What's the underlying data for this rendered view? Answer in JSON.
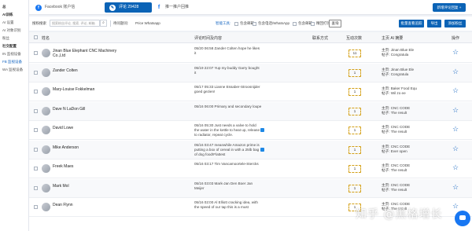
{
  "sidebar": {
    "items": [
      {
        "label": "总",
        "type": "group"
      },
      {
        "label": "AI训练",
        "type": "group"
      },
      {
        "label": "AI 设置",
        "type": "item"
      },
      {
        "label": "AI 对象识别",
        "type": "item"
      },
      {
        "label": "粉丝",
        "type": "item"
      },
      {
        "label": "社交配置",
        "type": "group"
      },
      {
        "label": "IN 监视设备",
        "type": "item"
      },
      {
        "label": "FB 监视设备",
        "type": "active"
      },
      {
        "label": "WA 监视设备",
        "type": "item"
      }
    ]
  },
  "topbar": {
    "tabs": [
      {
        "label": "Facebook 账户信",
        "icon": "f"
      },
      {
        "label": "评论  29428",
        "icon": "✎"
      },
      {
        "label": "推一推户回推",
        "icon": "f"
      }
    ],
    "new_button": "新增评论回复 +"
  },
  "toolbar": {
    "search_label": "搜粉搜索",
    "search_placeholder": "搜索粉丝评论, 搜索, 评论, 邮箱",
    "search_icon": "search-icon",
    "filter_label": "待问题问:",
    "filter_value": "Price  Whatsapp",
    "tag_label": "智能工具:",
    "checks": [
      "包含邮箱",
      "包含电话/WhatsApp",
      "包含邮箱",
      "精回打领"
    ],
    "query_button": "查询",
    "batch_button": "批量查看追踪",
    "export_button": "导出",
    "add_button": "添加粉丝"
  },
  "table": {
    "headers": [
      "姓名",
      "评论时间及内容",
      "联系方式",
      "互动次数",
      "主页 Al 摘要",
      "操作"
    ],
    "rows": [
      {
        "name": "Jinan Blue Elephant CNC Machinery Co.,Ltd",
        "message": "05/20 06:58 Zander Colten hope he likes it",
        "flag": false,
        "count": "11",
        "rel1": "主页: Jinan Blue Ele",
        "rel2": "帖子: Congratula"
      },
      {
        "name": "Zander Colten",
        "message": "05/19 22:07 Yup my buddy Garry bought it",
        "flag": false,
        "count": "1",
        "rel1": "主页: Jinan Blue Ele",
        "rel2": "帖子: Congratula"
      },
      {
        "name": "Mary-Louise Fokkelman",
        "message": "05/17 05:33 Lianne Essaber-Stroosnijder goed gezien!",
        "flag": false,
        "count": "1",
        "rel1": "主页: Baker Food Equ",
        "rel2": "帖子: Wil zo ee"
      },
      {
        "name": "Dave N LaDon Gill",
        "message": "05/16 06:00 Primary and secondary loupe",
        "flag": false,
        "count": "1",
        "rel1": "主页: CNC CODE",
        "rel2": "帖子: The result"
      },
      {
        "name": "David Lowe",
        "message": "05/16 05:30 Just needs a valve to hold the water in the kettle to heat up, release to radiator, repeat cycle.",
        "flag": true,
        "count": "1",
        "rel1": "主页: CNC CODE",
        "rel2": "帖子: The result"
      },
      {
        "name": "Mike Anderson",
        "message": "05/16 03:47 meanwhile Amazon prime is putting a box of cereal in with a 25lb bag of dog food!Flattest",
        "flag": true,
        "count": "1",
        "rel1": "主页: CNC CODE",
        "rel2": "帖子: Ever open"
      },
      {
        "name": "Freek Maes",
        "message": "05/16 03:17 Tim Vancamoortele-Stercks",
        "flag": false,
        "count": "1",
        "rel1": "主页: CNC CODE",
        "rel2": "帖子: The result"
      },
      {
        "name": "Mark Mol",
        "message": "05/16 03:03 Mark-Jan Den Boer Jan Meijer",
        "flag": false,
        "count": "1",
        "rel1": "主页: CNC CODE",
        "rel2": "帖子: The result"
      },
      {
        "name": "Dean Flynn",
        "message": "05/16 02:00 Al Elliott cracking idea, with the speed of our tap this is a must",
        "flag": false,
        "count": "1",
        "rel1": "主页: CNC CODE",
        "rel2": "帖子: The result"
      }
    ],
    "action_icon": "star-icon"
  },
  "watermark": "知乎 @黑格增长",
  "colors": {
    "primary": "#0b63b6",
    "accent": "#1565c0",
    "count_border": "#d4a017"
  }
}
